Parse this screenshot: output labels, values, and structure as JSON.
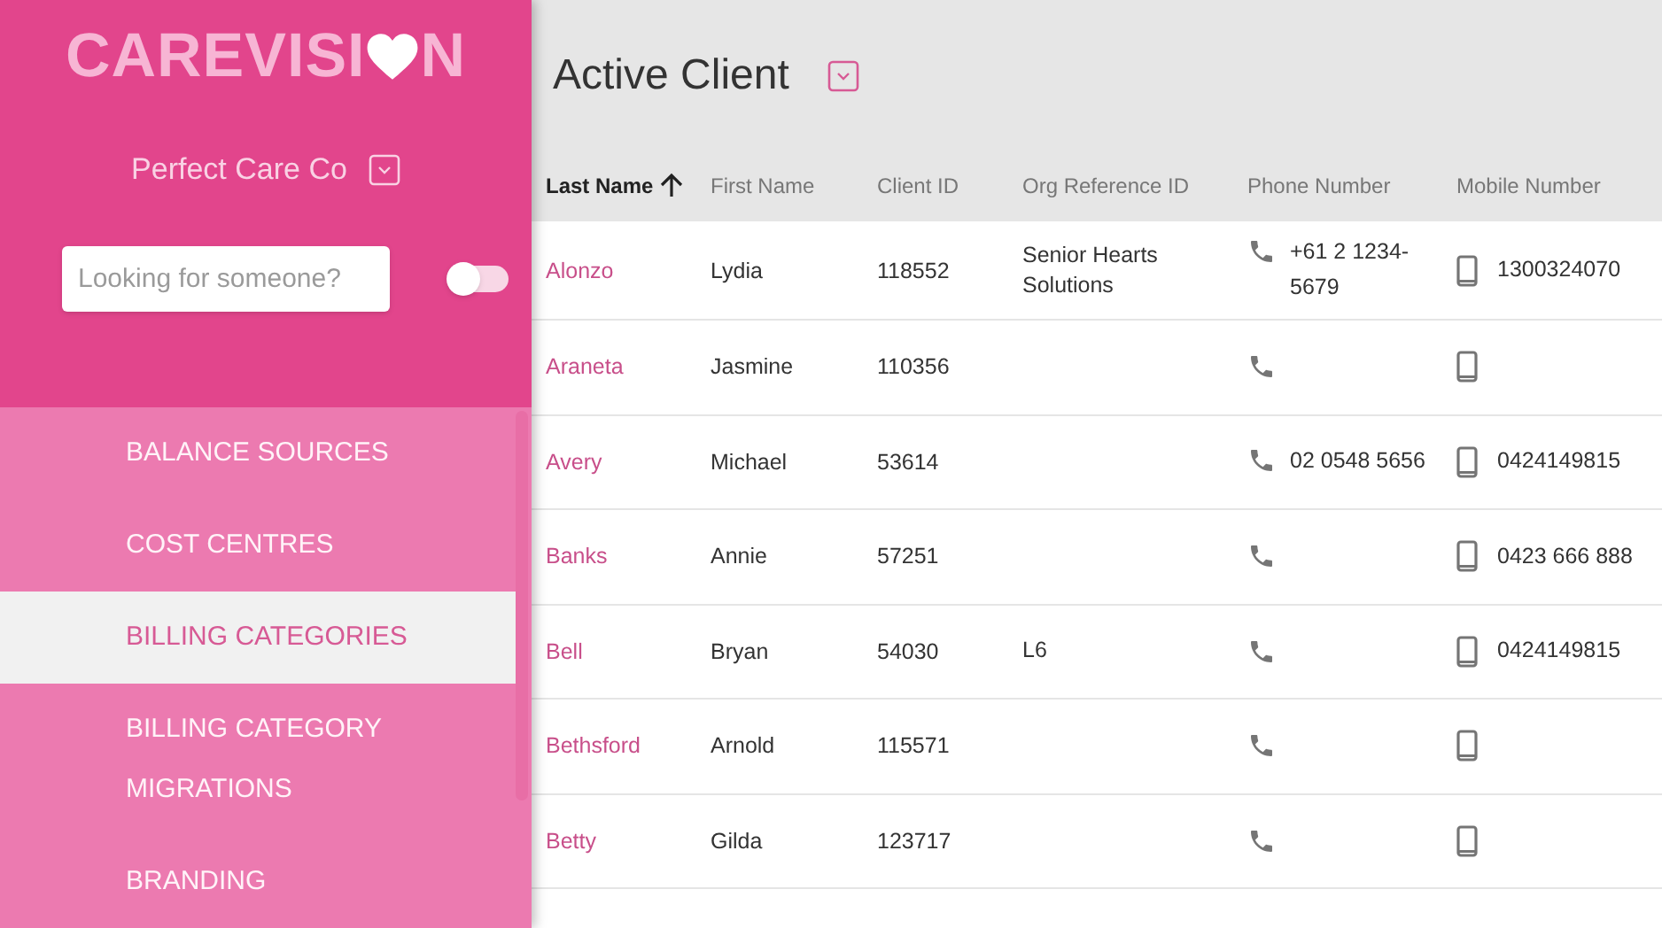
{
  "sidebar": {
    "logo_text_before": "CAREVISI",
    "logo_text_after": "N",
    "organisation": "Perfect Care Co",
    "search": {
      "placeholder": "Looking for someone?"
    },
    "toggle": {
      "on": false
    },
    "items": [
      {
        "label": "BALANCE SOURCES",
        "selected": false
      },
      {
        "label": "COST CENTRES",
        "selected": false
      },
      {
        "label": "BILLING CATEGORIES",
        "selected": true
      },
      {
        "label": "BILLING CATEGORY MIGRATIONS",
        "selected": false
      },
      {
        "label": "BRANDING",
        "selected": false
      }
    ]
  },
  "main": {
    "title": "Active Client",
    "table": {
      "columns": [
        {
          "label": "Last Name",
          "sorted": true
        },
        {
          "label": "First Name",
          "sorted": false
        },
        {
          "label": "Client ID",
          "sorted": false
        },
        {
          "label": "Org Reference ID",
          "sorted": false
        },
        {
          "label": "Phone Number",
          "sorted": false
        },
        {
          "label": "Mobile Number",
          "sorted": false
        }
      ],
      "rows": [
        {
          "last_name": "Alonzo",
          "first_name": "Lydia",
          "client_id": "118552",
          "org_reference_id": "Senior Hearts Solutions",
          "phone": "+61 2 1234-5679",
          "mobile": "1300324070"
        },
        {
          "last_name": "Araneta",
          "first_name": "Jasmine",
          "client_id": "110356",
          "org_reference_id": "",
          "phone": "",
          "mobile": ""
        },
        {
          "last_name": "Avery",
          "first_name": "Michael",
          "client_id": "53614",
          "org_reference_id": "",
          "phone": "02 0548 5656",
          "mobile": "0424149815"
        },
        {
          "last_name": "Banks",
          "first_name": "Annie",
          "client_id": "57251",
          "org_reference_id": "",
          "phone": "",
          "mobile": "0423 666 888"
        },
        {
          "last_name": "Bell",
          "first_name": "Bryan",
          "client_id": "54030",
          "org_reference_id": "L6",
          "phone": "",
          "mobile": "0424149815"
        },
        {
          "last_name": "Bethsford",
          "first_name": "Arnold",
          "client_id": "115571",
          "org_reference_id": "",
          "phone": "",
          "mobile": ""
        },
        {
          "last_name": "Betty",
          "first_name": "Gilda",
          "client_id": "123717",
          "org_reference_id": "",
          "phone": "",
          "mobile": ""
        }
      ]
    }
  }
}
